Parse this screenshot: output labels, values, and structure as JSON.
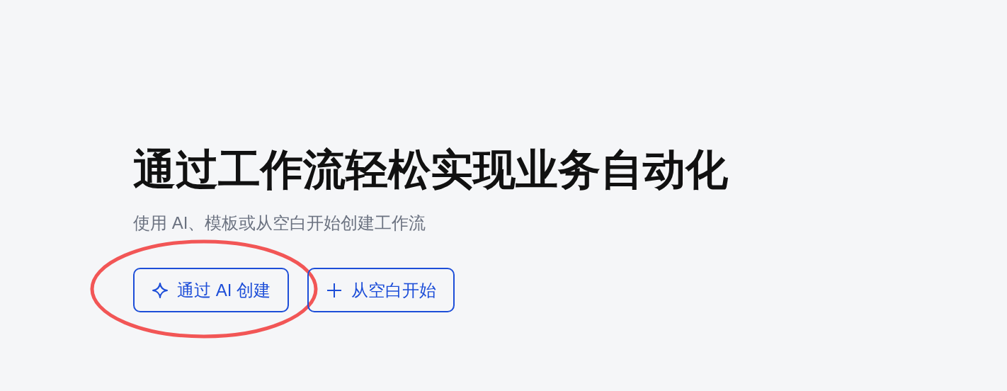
{
  "heading": "通过工作流轻松实现业务自动化",
  "subtitle": "使用 AI、模板或从空白开始创建工作流",
  "buttons": [
    {
      "label": "通过 AI 创建",
      "kind": "ai",
      "highlighted": true
    },
    {
      "label": "从空白开始",
      "kind": "blank",
      "highlighted": false
    }
  ]
}
